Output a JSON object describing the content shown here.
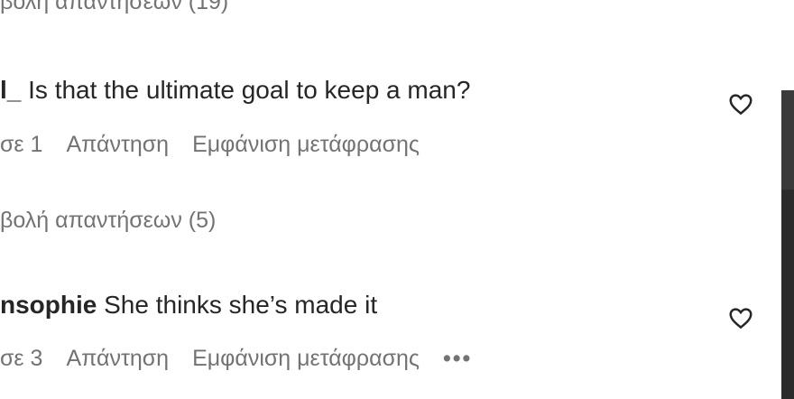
{
  "replies_toggle_1": "βολή απαντήσεων (19)",
  "comments": [
    {
      "username": "l_",
      "text": "Is that the ultimate goal to keep a man?",
      "likes": "σε 1",
      "reply": "Απάντηση",
      "translate": "Εμφάνιση μετάφρασης",
      "replies_toggle": "βολή απαντήσεων (5)"
    },
    {
      "username": "nsophie",
      "text": "She thinks she’s made it",
      "likes": "σε 3",
      "reply": "Απάντηση",
      "translate": "Εμφάνιση μετάφρασης",
      "more": "•••"
    }
  ],
  "icons": {
    "like": "heart-outline-icon"
  }
}
